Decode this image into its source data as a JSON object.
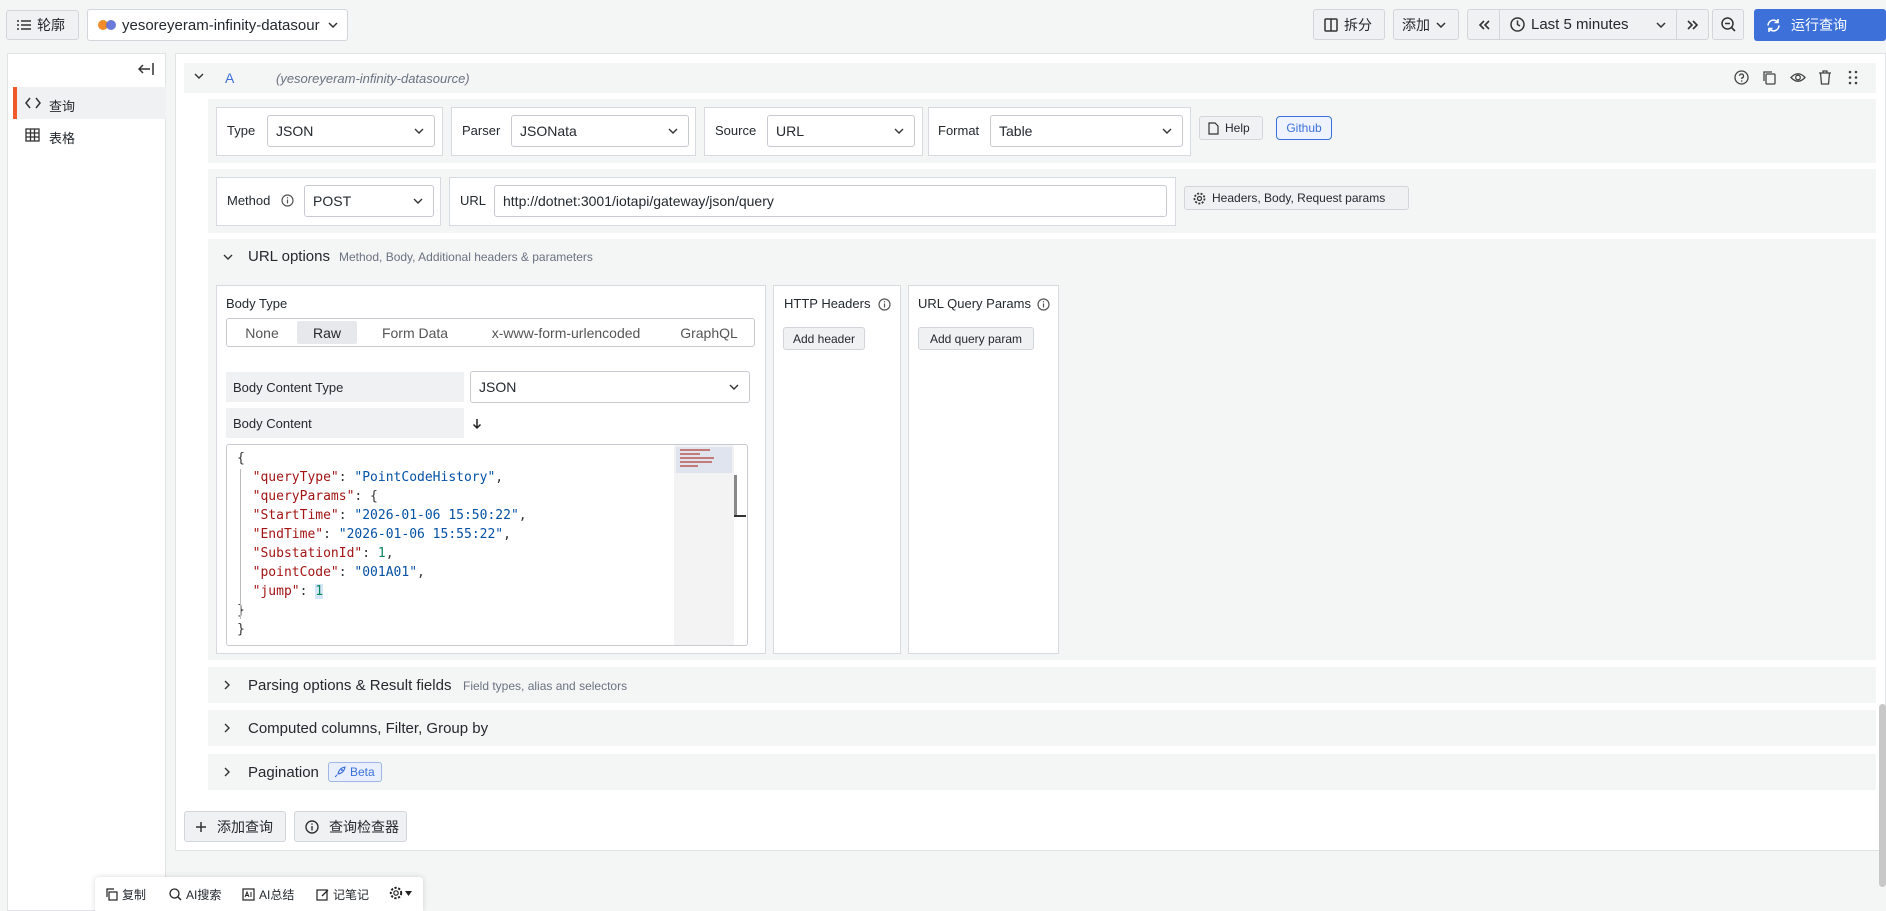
{
  "topbar": {
    "outline_label": "轮廓",
    "datasource_name": "yesoreyeram-infinity-datasour",
    "split_label": "拆分",
    "add_label": "添加",
    "time_range": "Last 5 minutes",
    "run_query_label": "运行查询"
  },
  "sidebar": {
    "items": [
      {
        "label": "查询"
      },
      {
        "label": "表格"
      }
    ]
  },
  "query": {
    "ref_id": "A",
    "datasource": "(yesoreyeram-infinity-datasource)"
  },
  "settings_row": {
    "type_label": "Type",
    "type_value": "JSON",
    "parser_label": "Parser",
    "parser_value": "JSONata",
    "source_label": "Source",
    "source_value": "URL",
    "format_label": "Format",
    "format_value": "Table",
    "help_label": "Help",
    "github_label": "Github"
  },
  "request_row": {
    "method_label": "Method",
    "method_value": "POST",
    "url_label": "URL",
    "url_value": "http://dotnet:3001/iotapi/gateway/json/query",
    "headers_button": "Headers, Body, Request params"
  },
  "url_options": {
    "title": "URL options",
    "subtitle": "Method, Body, Additional headers & parameters",
    "body_type_label": "Body Type",
    "body_types": [
      "None",
      "Raw",
      "Form Data",
      "x-www-form-urlencoded",
      "GraphQL"
    ],
    "selected_body_type": "Raw",
    "body_content_type_label": "Body Content Type",
    "body_content_type_value": "JSON",
    "body_content_label": "Body Content",
    "code": {
      "open": "{",
      "queryType_key": "\"queryType\"",
      "queryType_val": "\"PointCodeHistory\"",
      "queryParams_key": "\"queryParams\"",
      "StartTime_key": "\"StartTime\"",
      "StartTime_val": "\"2026-01-06 15:50:22\"",
      "EndTime_key": "\"EndTime\"",
      "EndTime_val": "\"2026-01-06 15:55:22\"",
      "SubstationId_key": "\"SubstationId\"",
      "SubstationId_val": "1",
      "pointCode_key": "\"pointCode\"",
      "pointCode_val": "\"001A01\"",
      "jump_key": "\"jump\"",
      "jump_val": "1",
      "close_inner": "}",
      "close": "}"
    },
    "http_headers_label": "HTTP Headers",
    "add_header_label": "Add header",
    "query_params_label": "URL Query Params",
    "add_query_param_label": "Add query param"
  },
  "sections": {
    "parsing_title": "Parsing options & Result fields",
    "parsing_sub": "Field types, alias and selectors",
    "computed_title": "Computed columns, Filter, Group by",
    "pagination_title": "Pagination",
    "beta_label": "Beta"
  },
  "footer_buttons": {
    "add_query": "添加查询",
    "query_inspector": "查询检查器"
  },
  "bottom_toolbar": {
    "copy": "复制",
    "ai_search": "AI搜索",
    "ai_summary": "AI总结",
    "notes": "记笔记"
  },
  "colors": {
    "primary": "#3d71d9",
    "accent_bar": "#f05a28"
  }
}
